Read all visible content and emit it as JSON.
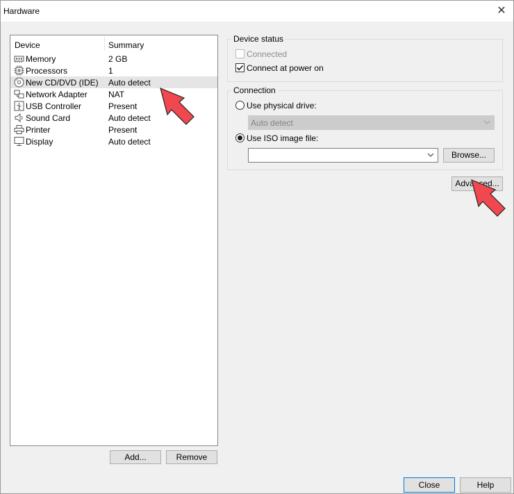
{
  "window": {
    "title": "Hardware",
    "close_glyph": "✕"
  },
  "device_list": {
    "columns": {
      "device": "Device",
      "summary": "Summary"
    },
    "rows": [
      {
        "name": "Memory",
        "summary": "2 GB",
        "icon": "memory-icon"
      },
      {
        "name": "Processors",
        "summary": "1",
        "icon": "processor-icon"
      },
      {
        "name": "New CD/DVD (IDE)",
        "summary": "Auto detect",
        "icon": "cd-dvd-icon",
        "selected": true
      },
      {
        "name": "Network Adapter",
        "summary": "NAT",
        "icon": "network-adapter-icon"
      },
      {
        "name": "USB Controller",
        "summary": "Present",
        "icon": "usb-icon"
      },
      {
        "name": "Sound Card",
        "summary": "Auto detect",
        "icon": "sound-card-icon"
      },
      {
        "name": "Printer",
        "summary": "Present",
        "icon": "printer-icon"
      },
      {
        "name": "Display",
        "summary": "Auto detect",
        "icon": "display-icon"
      }
    ],
    "add_label": "Add...",
    "remove_label": "Remove"
  },
  "device_status": {
    "title": "Device status",
    "connected_label": "Connected",
    "connected_checked": false,
    "connect_power_label": "Connect at power on",
    "connect_power_checked": true
  },
  "connection": {
    "title": "Connection",
    "physical_label": "Use physical drive:",
    "physical_selected": false,
    "physical_value": "Auto detect",
    "iso_label": "Use ISO image file:",
    "iso_selected": true,
    "iso_value": "",
    "browse_label": "Browse..."
  },
  "advanced_label": "Advanced...",
  "footer": {
    "close_label": "Close",
    "help_label": "Help"
  },
  "annotation_color": "#f0484e"
}
